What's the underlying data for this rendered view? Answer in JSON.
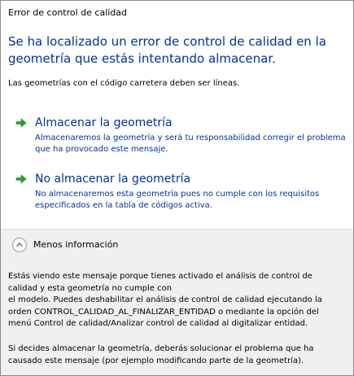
{
  "window": {
    "title": "Error de control de calidad"
  },
  "main": {
    "heading": "Se ha localizado un error de control de calidad en la geometría que estás intentando almacenar.",
    "intro": "Las geometrías con el código carretera deben ser líneas."
  },
  "commands": [
    {
      "icon": "green-arrow-icon",
      "title": "Almacenar la geometría",
      "description": "Almacenaremos la geometría y será tu responsabilidad corregir el problema que ha provocado este mensaje."
    },
    {
      "icon": "green-arrow-icon",
      "title": "No almacenar la geometría",
      "description": "No almacenaremos esta geometría pues no cumple con los requisitos especificados en la tabla de códigos activa."
    }
  ],
  "footer": {
    "toggle_icon": "chevron-up-icon",
    "toggle_label": "Menos información",
    "details_lines_1": [
      "Estás viendo este mensaje porque tienes activado el análisis de control de",
      "calidad y esta geometría no cumple con",
      "el modelo. Puedes deshabilitar el análisis de control de calidad ejecutando la",
      "orden CONTROL_CALIDAD_AL_FINALIZAR_ENTIDAD o mediante la opción del",
      "menú Control de calidad/Analizar control de calidad al digitalizar entidad."
    ],
    "details_lines_2": [
      "Si decides almacenar la geometría, deberás solucionar el problema que ha",
      "causado este mensaje (por ejemplo modificando parte de la geometría)."
    ]
  },
  "colors": {
    "accent_text": "#003399",
    "arrow": "#2fa12f",
    "footer_bg": "#f0f0f0"
  }
}
